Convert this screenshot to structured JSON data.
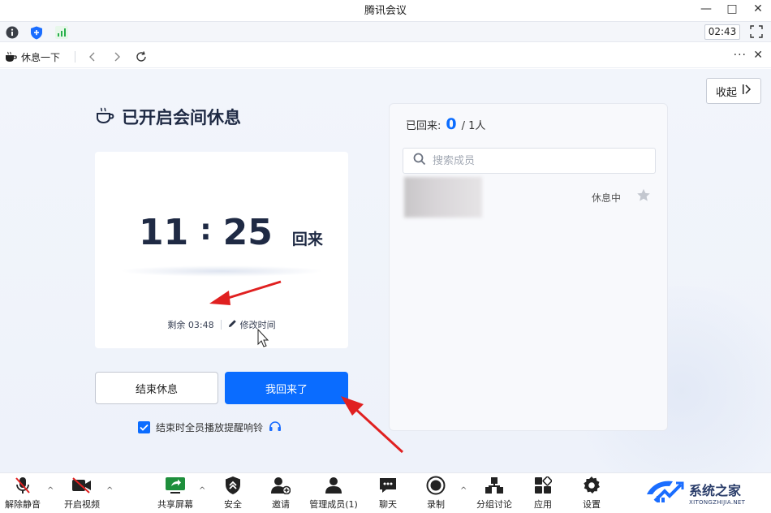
{
  "window": {
    "title": "腾讯会议",
    "controls": [
      "—",
      "□",
      "✕"
    ]
  },
  "statusbar": {
    "timer": "02:43",
    "icons": [
      "info-icon",
      "shield-icon",
      "signal-icon",
      "fullscreen-icon"
    ]
  },
  "tab": {
    "label": "休息一下",
    "more": "···",
    "close": "✕"
  },
  "break_panel": {
    "title": "已开启会间休息",
    "time_hour": "11",
    "time_colon": ":",
    "time_minute": "25",
    "time_suffix": "回来",
    "remaining": "剩余 03:48",
    "edit_time": "修改时间",
    "end_button": "结束休息",
    "back_button": "我回来了",
    "remind_label": "结束时全员播放提醒响铃",
    "remind_checked": true
  },
  "collapse_button": "收起",
  "member_panel": {
    "returned_label": "已回来:",
    "returned_count": "0",
    "total": "/ 1人",
    "search_placeholder": "搜索成员",
    "members": [
      {
        "status": "休息中"
      }
    ]
  },
  "toolbar": {
    "items": [
      {
        "label": "解除静音",
        "icon": "mic-off-icon"
      },
      {
        "label": "开启视频",
        "icon": "video-off-icon"
      },
      {
        "label": "共享屏幕",
        "icon": "share-screen-icon"
      },
      {
        "label": "安全",
        "icon": "security-icon"
      },
      {
        "label": "邀请",
        "icon": "invite-icon"
      },
      {
        "label": "管理成员(1)",
        "icon": "members-icon"
      },
      {
        "label": "聊天",
        "icon": "chat-icon"
      },
      {
        "label": "录制",
        "icon": "record-icon"
      },
      {
        "label": "分组讨论",
        "icon": "breakout-icon"
      },
      {
        "label": "应用",
        "icon": "apps-icon"
      },
      {
        "label": "设置",
        "icon": "settings-icon"
      }
    ]
  },
  "watermark": {
    "main": "系统之家",
    "sub": "XITONGZHIJIA.NET"
  },
  "colors": {
    "accent": "#0a6cff",
    "title_text": "#1f2a44",
    "annotation": "#e02020"
  }
}
